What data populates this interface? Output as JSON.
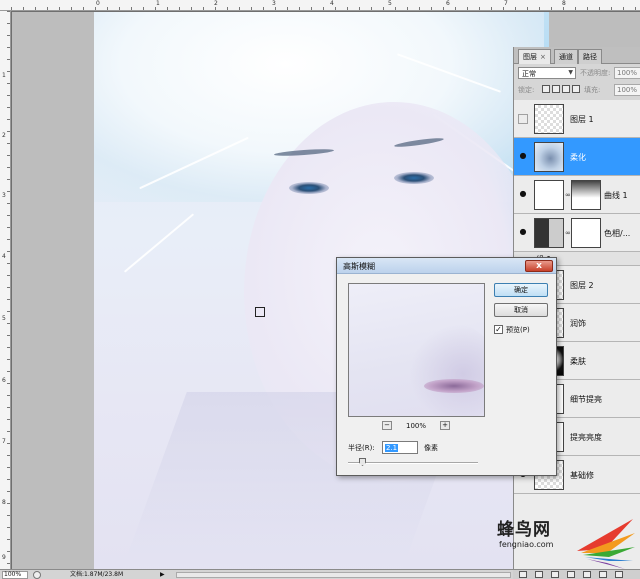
{
  "rulers": {
    "top_numbers": [
      "0",
      "1",
      "2",
      "3",
      "4",
      "5",
      "6",
      "7",
      "8"
    ],
    "left_numbers": [
      "1",
      "2",
      "3",
      "4",
      "5",
      "6",
      "7",
      "8",
      "9"
    ]
  },
  "layers_panel": {
    "tabs": [
      {
        "label": "图层",
        "close": "×"
      },
      {
        "label": "通道"
      },
      {
        "label": "路径"
      }
    ],
    "blend_mode": "正常",
    "opacity_label": "不透明度:",
    "opacity_value": "100%",
    "lock_label": "锁定:",
    "fill_label": "填充:",
    "fill_value": "100%",
    "layers": [
      {
        "name": "图层 1",
        "visible": false
      },
      {
        "name": "柔化",
        "visible": true,
        "selected": true
      },
      {
        "name": "曲线 1",
        "visible": true
      },
      {
        "name": "色相/...",
        "visible": true
      },
      {
        "name": "组 1"
      },
      {
        "name": "图层 2",
        "visible": true
      },
      {
        "name": "润饰",
        "visible": true
      },
      {
        "name": "柔肤",
        "visible": true
      },
      {
        "name": "细节提亮",
        "visible": true
      },
      {
        "name": "提亮亮度",
        "visible": true
      },
      {
        "name": "基础修",
        "visible": true
      }
    ]
  },
  "dialog": {
    "title": "高斯模糊",
    "close": "x",
    "ok_label": "确定",
    "cancel_label": "取消",
    "preview_label": "预览(P)",
    "preview_checked": true,
    "zoom_minus": "−",
    "zoom_plus": "+",
    "zoom_value": "100%",
    "radius_label": "半径(R):",
    "radius_value": "2.1",
    "radius_unit": "像素"
  },
  "status_bar": {
    "zoom": "100%",
    "doc_info": "文档:1.87M/23.8M",
    "arrow": "▶"
  },
  "watermark": {
    "text_cn": "蜂鸟网",
    "text_en": "fengniao.com"
  },
  "colors": {
    "selected_layer": "#3399ff",
    "dialog_close": "#c7412b"
  }
}
